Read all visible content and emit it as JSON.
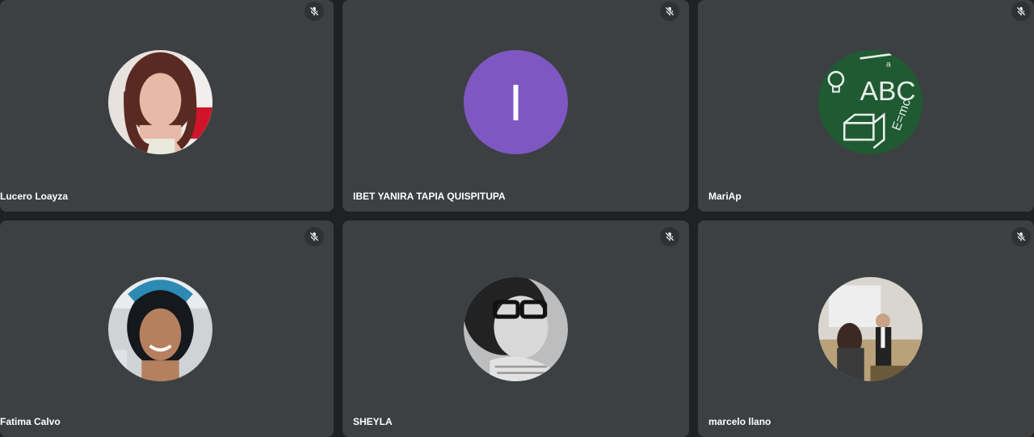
{
  "participants": [
    {
      "name": "Lucero Loayza",
      "avatar": "photo-woman-long-hair",
      "muted": true
    },
    {
      "name": "IBET YANIRA TAPIA QUISPITUPA",
      "avatar_initial": "I",
      "avatar_color": "#7e57c2",
      "muted": true
    },
    {
      "name": "MariAp",
      "avatar": "chalkboard-abc",
      "muted": true
    },
    {
      "name": "Fatima Calvo",
      "avatar": "photo-woman-blue-hair",
      "muted": true
    },
    {
      "name": "SHEYLA",
      "avatar": "photo-bw-glasses",
      "muted": true
    },
    {
      "name": "marcelo llano",
      "avatar": "photo-presentation",
      "muted": true
    }
  ],
  "icons": {
    "mute": "mic-off-icon"
  },
  "colors": {
    "background": "#202124",
    "tile": "#3c4043",
    "name_text": "#ffffff"
  }
}
